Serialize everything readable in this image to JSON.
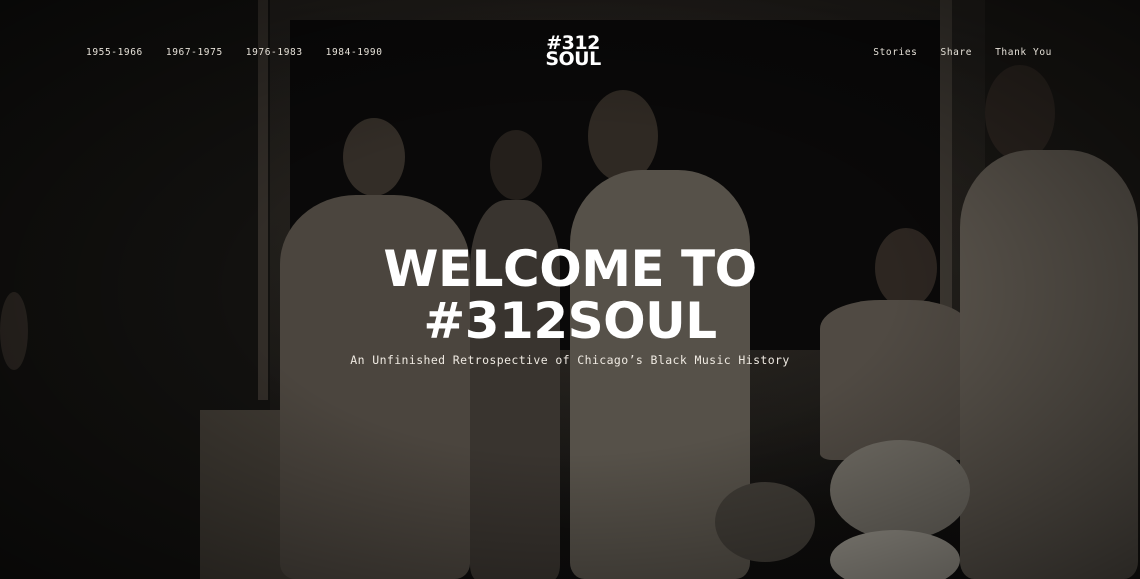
{
  "nav": {
    "eras": [
      {
        "label": "1955-1966"
      },
      {
        "label": "1967-1975"
      },
      {
        "label": "1976-1983"
      },
      {
        "label": "1984-1990"
      }
    ],
    "links": [
      {
        "label": "Stories"
      },
      {
        "label": "Share"
      },
      {
        "label": "Thank You"
      }
    ]
  },
  "logo": {
    "line1": "#312",
    "line2": "SOUL"
  },
  "hero": {
    "headline_line1": "WELCOME TO",
    "headline_line2": "#312SOUL",
    "subtitle": "An Unfinished Retrospective of Chicago’s Black Music History",
    "background_image": "black-and-white-photo-jazz-band-musicians"
  }
}
